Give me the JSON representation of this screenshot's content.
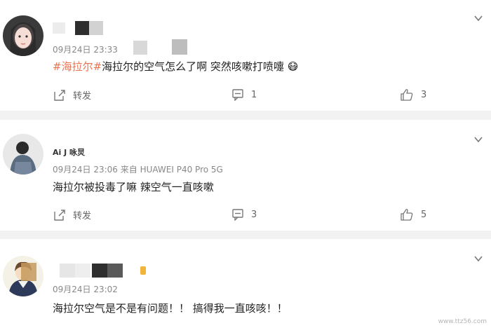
{
  "posts": [
    {
      "meta": "09月24日 23:33",
      "hashtag": "#海拉尔#",
      "text": "海拉尔的空气怎么了啊 突然咳嗽打喷嚏",
      "emoji": "😷",
      "share_label": "转发",
      "comment_count": "1",
      "like_count": "3"
    },
    {
      "username": "Ai J 咏炅",
      "meta": "09月24日 23:06  来自 HUAWEI P40 Pro 5G",
      "text": "海拉尔被投毒了嘛 辣空气一直咳嗽",
      "share_label": "转发",
      "comment_count": "3",
      "like_count": "5"
    },
    {
      "meta": "09月24日 23:02",
      "text": "海拉尔空气是不是有问题！！ 搞得我一直咳咳！！"
    }
  ],
  "watermark": "www.ttz56.com",
  "colors": {
    "hashtag": "#eb7350",
    "background": "#f2f2f2"
  },
  "icons": [
    "chevron-down-icon",
    "share-icon",
    "comment-icon",
    "like-icon"
  ]
}
